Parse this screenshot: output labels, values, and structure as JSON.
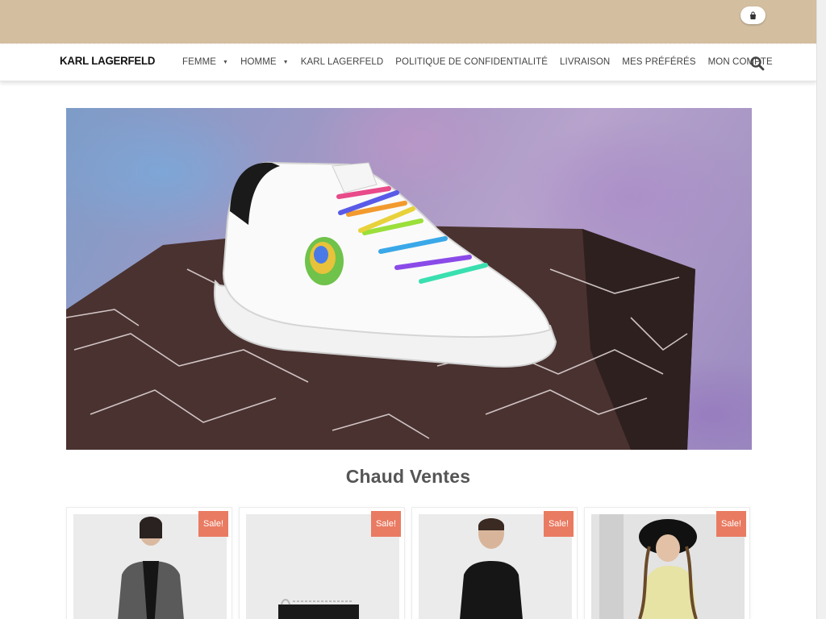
{
  "brand": {
    "logo": "KARL LAGERFELD"
  },
  "nav": {
    "items": [
      {
        "label": "FEMME",
        "dropdown": true
      },
      {
        "label": "HOMME",
        "dropdown": true
      },
      {
        "label": "KARL LAGERFELD",
        "dropdown": false
      },
      {
        "label": "POLITIQUE DE CONFIDENTIALITÉ",
        "dropdown": false
      },
      {
        "label": "LIVRAISON",
        "dropdown": false
      },
      {
        "label": "MES PRÉFÉRÉS",
        "dropdown": false
      },
      {
        "label": "MON COMPTE",
        "dropdown": false
      }
    ],
    "caret_glyph": "▼"
  },
  "icons": {
    "cart": "shopping-bag-icon",
    "search": "search-icon"
  },
  "colors": {
    "topbar": "#d3bea0",
    "sale_badge": "#e97b62",
    "title": "#555555"
  },
  "main": {
    "section_title": "Chaud Ventes",
    "products": [
      {
        "badge": "Sale!"
      },
      {
        "badge": "Sale!"
      },
      {
        "badge": "Sale!"
      },
      {
        "badge": "Sale!"
      }
    ]
  }
}
